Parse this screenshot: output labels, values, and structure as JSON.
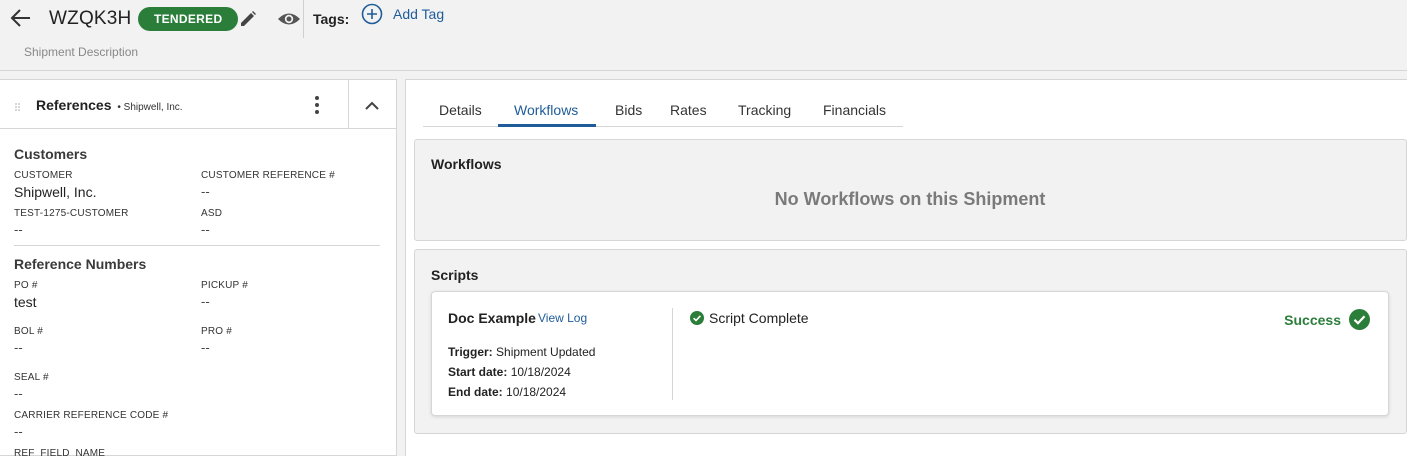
{
  "header": {
    "shipment_id": "WZQK3H",
    "status": "TENDERED",
    "tags_label": "Tags:",
    "add_tag_label": "Add Tag",
    "description": "Shipment Description"
  },
  "references": {
    "title": "References",
    "subtitle": "• Shipwell, Inc.",
    "customers_heading": "Customers",
    "customer_label": "CUSTOMER",
    "customer_value": "Shipwell, Inc.",
    "customer_ref_label": "CUSTOMER REFERENCE #",
    "customer_ref_value": "--",
    "test_label": "TEST-1275-CUSTOMER",
    "test_value": "--",
    "asd_label": "ASD",
    "asd_value": "--",
    "refnums_heading": "Reference Numbers",
    "po_label": "PO #",
    "po_value": "test",
    "pickup_label": "PICKUP #",
    "pickup_value": "--",
    "bol_label": "BOL #",
    "bol_value": "--",
    "pro_label": "PRO #",
    "pro_value": "--",
    "seal_label": "SEAL #",
    "seal_value": "--",
    "carrier_ref_label": "CARRIER REFERENCE CODE #",
    "carrier_ref_value": "--",
    "ref_field_label": "REF_FIELD_NAME"
  },
  "tabs": [
    "Details",
    "Workflows",
    "Bids",
    "Rates",
    "Tracking",
    "Financials"
  ],
  "active_tab": "Workflows",
  "workflows": {
    "title": "Workflows",
    "empty_message": "No Workflows on this Shipment"
  },
  "scripts": {
    "title": "Scripts",
    "name": "Doc Example",
    "view_log": "View Log",
    "trigger_label": "Trigger:",
    "trigger_value": "Shipment Updated",
    "start_label": "Start date:",
    "start_value": "10/18/2024",
    "end_label": "End date:",
    "end_value": "10/18/2024",
    "status_text": "Script Complete",
    "result": "Success"
  },
  "colors": {
    "brand_green": "#2b7d3a",
    "link_blue": "#1f5c99"
  }
}
